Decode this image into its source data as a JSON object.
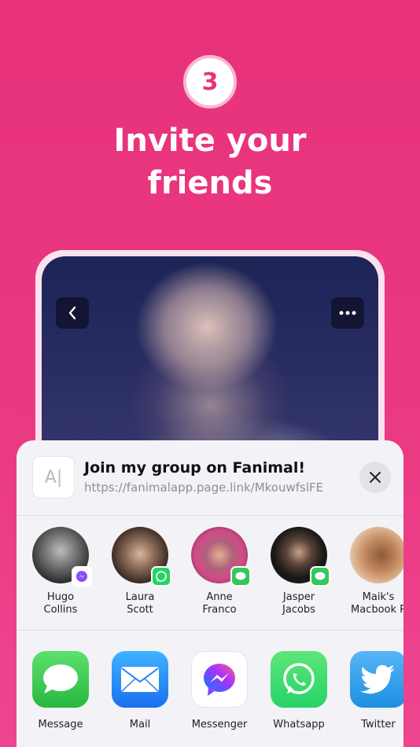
{
  "step": {
    "number": "3"
  },
  "headline": {
    "line1": "Invite your",
    "line2": "friends"
  },
  "sheet": {
    "title": "Join my group on Fanimal!",
    "link": "https://fanimalapp.page.link/MkouwfslFE",
    "thumb_text": "A|"
  },
  "people": [
    {
      "name": "Hugo\nCollins",
      "badge": "messenger-icon"
    },
    {
      "name": "Laura\nScott",
      "badge": "whatsapp-icon"
    },
    {
      "name": "Anne\nFranco",
      "badge": "messages-icon"
    },
    {
      "name": "Jasper\nJacobs",
      "badge": "messages-icon"
    },
    {
      "name": "Maik's\nMacbook P",
      "badge": ""
    }
  ],
  "apps": [
    {
      "label": "Message",
      "icon": "messages-icon",
      "color": "#34c759"
    },
    {
      "label": "Mail",
      "icon": "mail-icon",
      "color": "#1e88f5"
    },
    {
      "label": "Messenger",
      "icon": "messenger-icon",
      "color": "#ffffff"
    },
    {
      "label": "Whatsapp",
      "icon": "whatsapp-icon",
      "color": "#25d366"
    },
    {
      "label": "Twitter",
      "icon": "twitter-icon",
      "color": "#1da1f2"
    }
  ],
  "colors": {
    "brand": "#e8327a",
    "background": "#ea3a82",
    "sheet": "#f2f2f7"
  }
}
